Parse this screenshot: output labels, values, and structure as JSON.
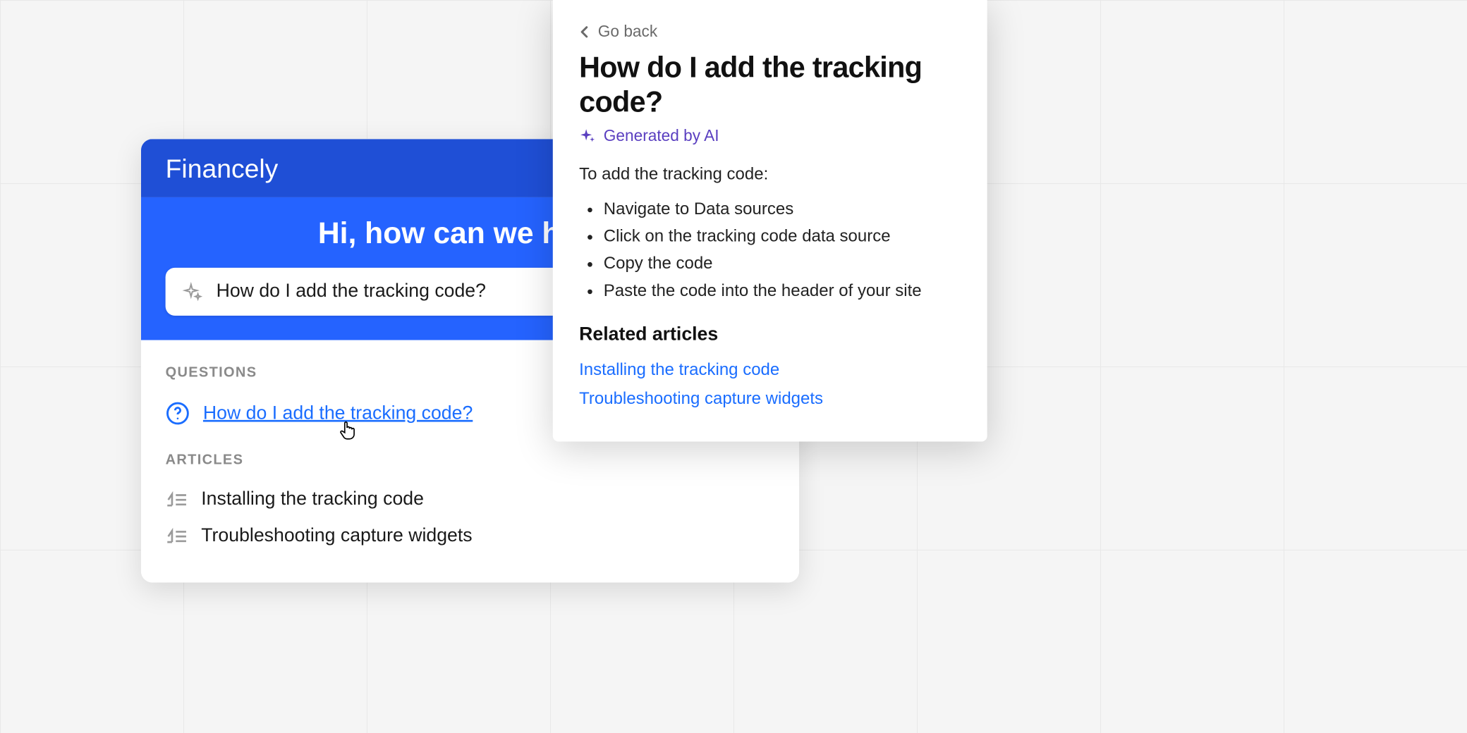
{
  "widget": {
    "brand": "Financely",
    "hero_title": "Hi, how can we help?",
    "search_query": "How do I add the tracking code?",
    "questions_label": "QUESTIONS",
    "articles_label": "ARTICLES",
    "questions": [
      {
        "label": "How do I add the tracking code?"
      }
    ],
    "articles": [
      {
        "label": "Installing the tracking code"
      },
      {
        "label": "Troubleshooting capture widgets"
      }
    ]
  },
  "ai_panel": {
    "back_label": "Go back",
    "title": "How do I add the tracking code?",
    "badge": "Generated by AI",
    "intro": "To add the tracking code:",
    "steps": [
      "Navigate to Data sources",
      "Click on the tracking code data source",
      "Copy the code",
      "Paste the code into the header of your site"
    ],
    "related_heading": "Related articles",
    "related": [
      "Installing the tracking code",
      "Troubleshooting capture widgets"
    ]
  },
  "colors": {
    "brand_primary": "#2563ff",
    "brand_dark": "#1f4fd6",
    "link": "#1a6dff",
    "ai_accent": "#5a3fc0"
  }
}
